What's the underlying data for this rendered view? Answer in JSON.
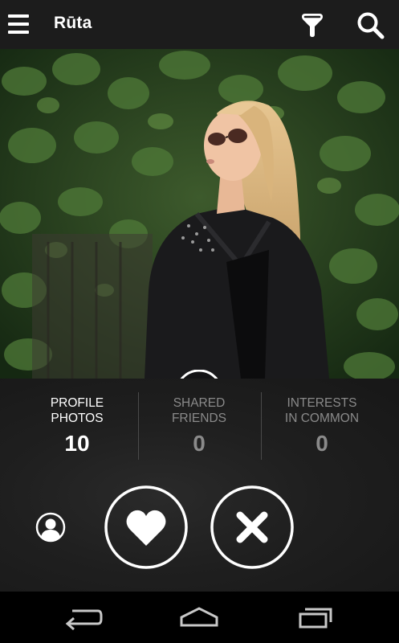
{
  "app_bar": {
    "title": "Rūta",
    "icons": [
      "menu-icon",
      "filter-icon",
      "search-icon"
    ]
  },
  "photo": {
    "description_icon": "gallery-grid-icon"
  },
  "stats": [
    {
      "label_line1": "PROFILE",
      "label_line2": "PHOTOS",
      "value": "10"
    },
    {
      "label_line1": "SHARED",
      "label_line2": "FRIENDS",
      "value": "0"
    },
    {
      "label_line1": "INTERESTS",
      "label_line2": "IN COMMON",
      "value": "0"
    }
  ],
  "actions": {
    "profile_icon": "person-icon",
    "like_icon": "heart-icon",
    "pass_icon": "x-icon"
  },
  "nav_bar": {
    "icons": [
      "back-icon",
      "home-icon",
      "recent-apps-icon"
    ]
  },
  "colors": {
    "app_bar_bg": "#1c1c1c",
    "panel_bg": "#1f1f1f",
    "active_text": "#ffffff",
    "dim_text": "#8a8a8a"
  }
}
